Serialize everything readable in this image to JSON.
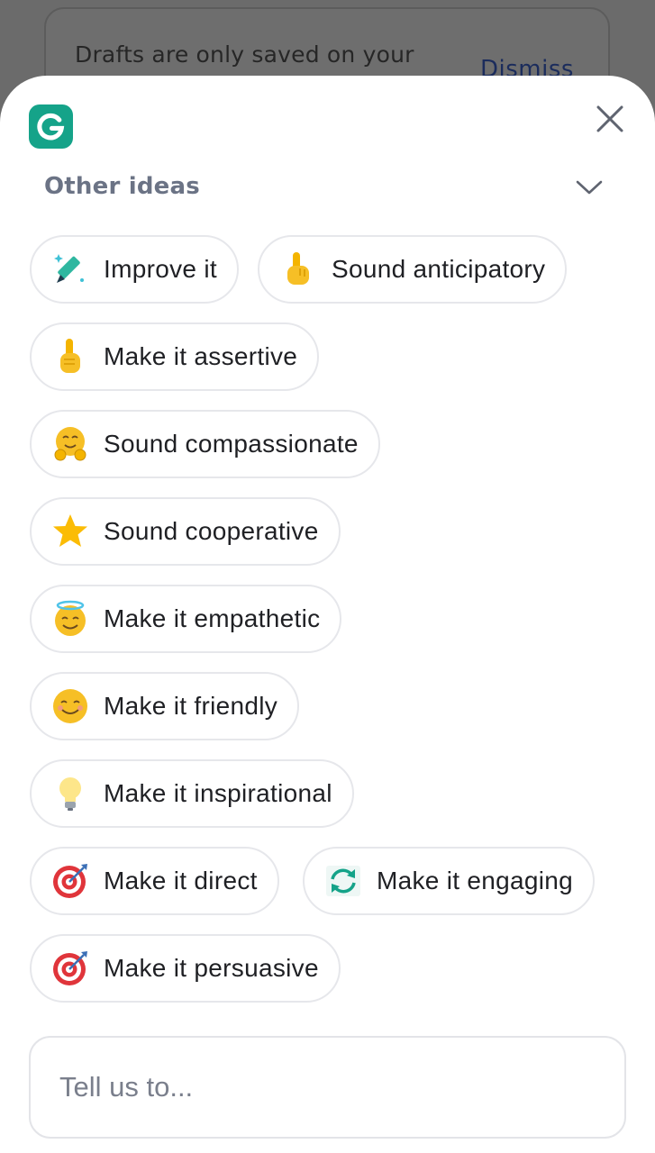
{
  "background": {
    "banner_text": "Drafts are only saved on your",
    "dismiss_label": "Dismiss"
  },
  "sheet": {
    "brand_color": "#15a389",
    "close_icon": "close-icon",
    "section_title": "Other ideas",
    "collapse_icon": "chevron-down-icon",
    "chips": [
      {
        "icon": "magic-pen-icon",
        "label": "Improve it"
      },
      {
        "icon": "pointing-hand-icon",
        "label": "Sound anticipatory"
      },
      {
        "icon": "index-finger-up-icon",
        "label": "Make it assertive"
      },
      {
        "icon": "hugging-face-icon",
        "label": "Sound compassionate"
      },
      {
        "icon": "star-icon",
        "label": "Sound cooperative"
      },
      {
        "icon": "halo-face-icon",
        "label": "Make it empathetic"
      },
      {
        "icon": "smiling-face-icon",
        "label": "Make it friendly"
      },
      {
        "icon": "light-bulb-icon",
        "label": "Make it inspirational"
      },
      {
        "icon": "bullseye-icon",
        "label": "Make it direct"
      },
      {
        "icon": "refresh-arrows-icon",
        "label": "Make it engaging"
      },
      {
        "icon": "bullseye-icon",
        "label": "Make it persuasive"
      }
    ],
    "input_placeholder": "Tell us to..."
  }
}
